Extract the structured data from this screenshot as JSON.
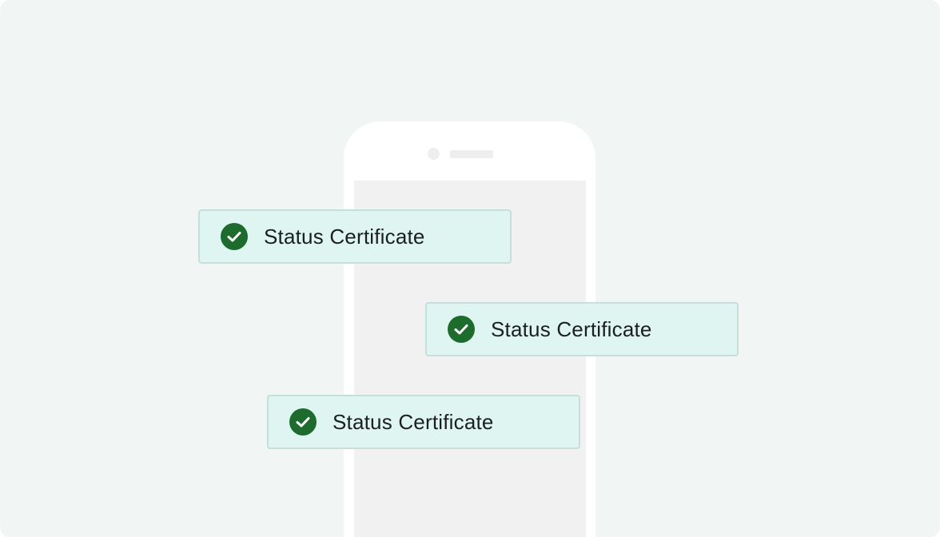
{
  "colors": {
    "background": "#f1f6f5",
    "phone_body": "#ffffff",
    "phone_screen": "#f1f1f1",
    "card_background": "#def5f2",
    "card_border": "#c6dfda",
    "check_fill": "#1e6b2e",
    "text": "#1b1f1e"
  },
  "cards": [
    {
      "label": "Status Certificate",
      "icon": "check-circle-icon"
    },
    {
      "label": "Status Certificate",
      "icon": "check-circle-icon"
    },
    {
      "label": "Status Certificate",
      "icon": "check-circle-icon"
    }
  ]
}
